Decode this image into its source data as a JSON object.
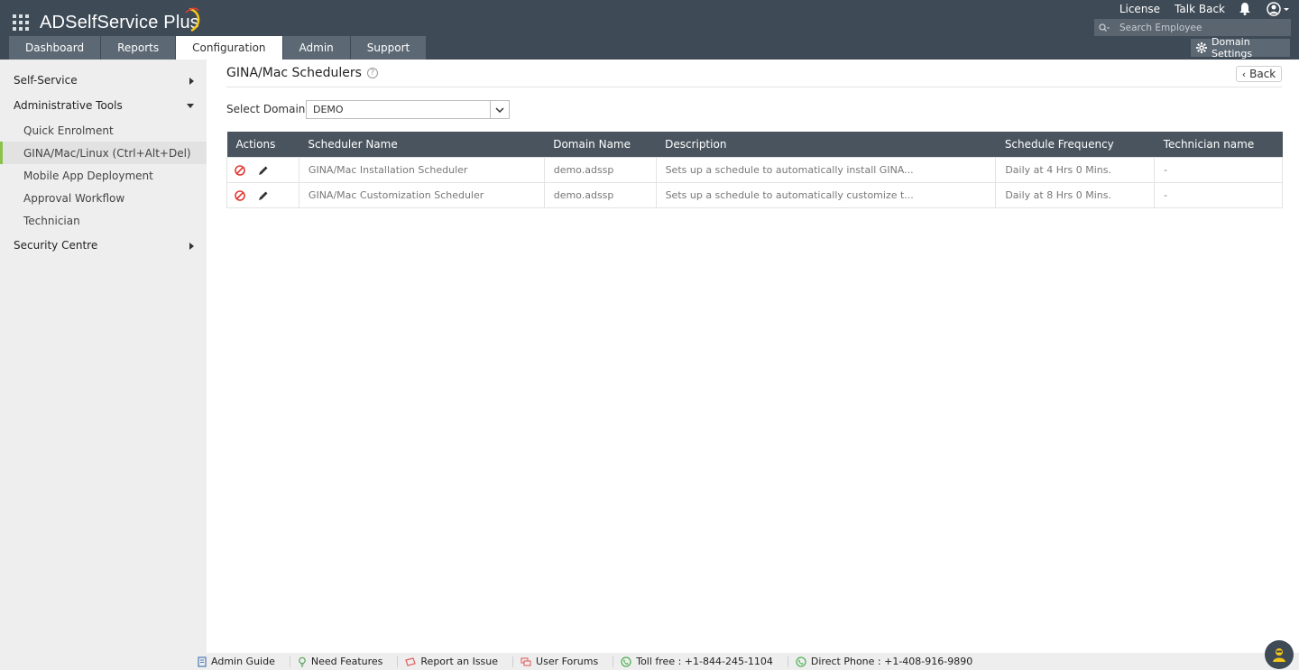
{
  "app": {
    "title": "ADSelfService Plus"
  },
  "header": {
    "links": [
      "License",
      "Talk Back"
    ],
    "search": {
      "placeholder": "Search Employee"
    },
    "tabs": [
      {
        "label": "Dashboard",
        "active": false
      },
      {
        "label": "Reports",
        "active": false
      },
      {
        "label": "Configuration",
        "active": true
      },
      {
        "label": "Admin",
        "active": false
      },
      {
        "label": "Support",
        "active": false
      }
    ],
    "domain_settings_label": "Domain Settings"
  },
  "sidebar": {
    "sections": [
      {
        "label": "Self-Service",
        "expanded": false
      },
      {
        "label": "Administrative Tools",
        "expanded": true,
        "items": [
          {
            "label": "Quick Enrolment",
            "selected": false
          },
          {
            "label": "GINA/Mac/Linux (Ctrl+Alt+Del)",
            "selected": true
          },
          {
            "label": "Mobile App Deployment",
            "selected": false
          },
          {
            "label": "Approval Workflow",
            "selected": false
          },
          {
            "label": "Technician",
            "selected": false
          }
        ]
      },
      {
        "label": "Security Centre",
        "expanded": false
      }
    ]
  },
  "main": {
    "title": "GINA/Mac Schedulers",
    "back_label": "Back",
    "domain_label": "Select Domain",
    "domain_value": "DEMO",
    "table": {
      "headers": [
        "Actions",
        "Scheduler Name",
        "Domain Name",
        "Description",
        "Schedule Frequency",
        "Technician name"
      ],
      "rows": [
        {
          "scheduler_name": "GINA/Mac Installation Scheduler",
          "domain_name": "demo.adssp",
          "description": "Sets up a schedule to automatically install GINA...",
          "frequency": "Daily at 4 Hrs 0 Mins.",
          "technician": "-"
        },
        {
          "scheduler_name": "GINA/Mac Customization Scheduler",
          "domain_name": "demo.adssp",
          "description": "Sets up a schedule to automatically customize t...",
          "frequency": "Daily at 8 Hrs 0 Mins.",
          "technician": "-"
        }
      ]
    }
  },
  "footer": {
    "items": [
      {
        "label": "Admin Guide",
        "icon": "book-icon"
      },
      {
        "label": "Need Features",
        "icon": "lightbulb-icon"
      },
      {
        "label": "Report an Issue",
        "icon": "ticket-icon"
      },
      {
        "label": "User Forums",
        "icon": "forum-icon"
      },
      {
        "label": "Toll free : +1-844-245-1104",
        "icon": "phone-icon"
      },
      {
        "label": "Direct Phone : +1-408-916-9890",
        "icon": "phone-icon"
      }
    ]
  },
  "colors": {
    "header_bg": "#3e4a55",
    "tab_bg": "#5c6873",
    "sidebar_bg": "#eeeeee",
    "selected_accent": "#8bc34a",
    "table_header_bg": "#4a545e",
    "delete_red": "#e53935"
  }
}
